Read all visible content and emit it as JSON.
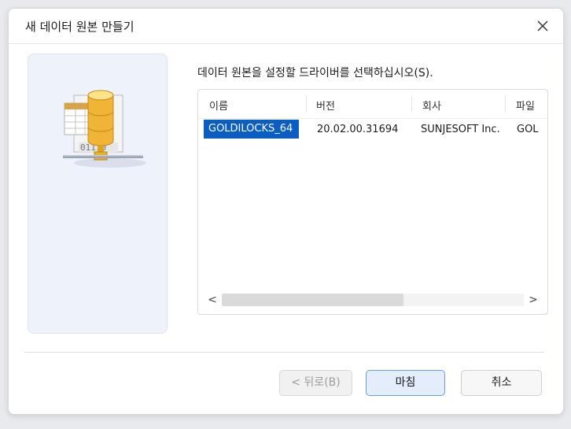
{
  "dialog": {
    "title": "새 데이터 원본 만들기",
    "close_icon": "close-icon"
  },
  "main": {
    "instruction": "데이터 원본을 설정할 드라이버를 선택하십시오(S).",
    "illustration_binary_text": "01110",
    "columns": [
      "이름",
      "버전",
      "회사",
      "파일"
    ],
    "rows": [
      {
        "name": "GOLDILOCKS_64",
        "version": "20.02.00.31694",
        "company": "SUNJESOFT Inc.",
        "file": "GOL",
        "selected": true
      }
    ],
    "scroll_left_label": "<",
    "scroll_right_label": ">"
  },
  "buttons": {
    "back": "< 뒤로(B)",
    "finish": "마침",
    "cancel": "취소"
  },
  "colors": {
    "selection": "#0a5dc2",
    "side_panel": "#eef2fb",
    "primary_border": "#6b9de2"
  }
}
